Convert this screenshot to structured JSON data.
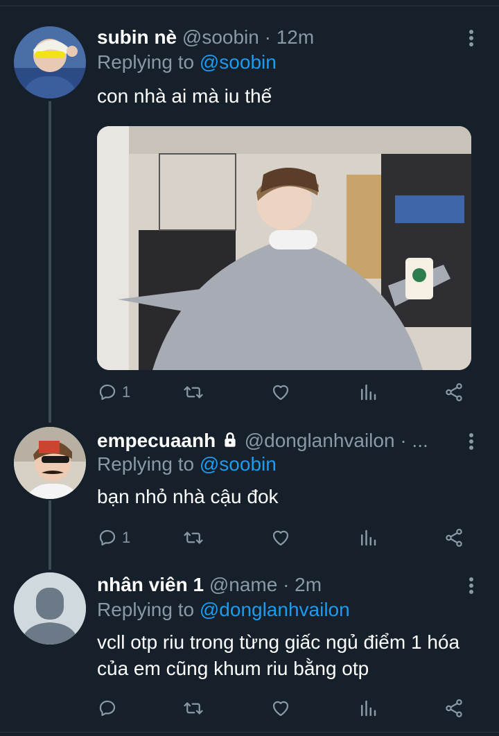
{
  "tweets": [
    {
      "name": "subin nè",
      "handle": "@soobin",
      "time": "· 12m",
      "replying_label": "Replying to",
      "replying_handle": "@soobin",
      "text": "con nhà ai mà iu thế",
      "reply_count": "1"
    },
    {
      "name": "empecuaanh",
      "handle": "@donglanhvailon · ...",
      "replying_label": "Replying to",
      "replying_handle": "@soobin",
      "text": "bạn nhỏ nhà cậu đok",
      "reply_count": "1"
    },
    {
      "name": "nhân viên 1",
      "handle": "@name",
      "time": "· 2m",
      "replying_label": "Replying to",
      "replying_handle": "@donglanhvailon",
      "text": "vcll otp riu trong từng giấc ngủ điểm 1 hóa của em cũng khum riu bằng otp",
      "reply_count": ""
    }
  ],
  "colors": {
    "background": "#15202b",
    "link": "#1d9bf0",
    "secondary_text": "#8b98a5",
    "thread_line": "#3d4a55"
  },
  "icons": [
    "reply-icon",
    "retweet-icon",
    "like-icon",
    "analytics-icon",
    "share-icon",
    "more-icon",
    "lock-icon"
  ]
}
